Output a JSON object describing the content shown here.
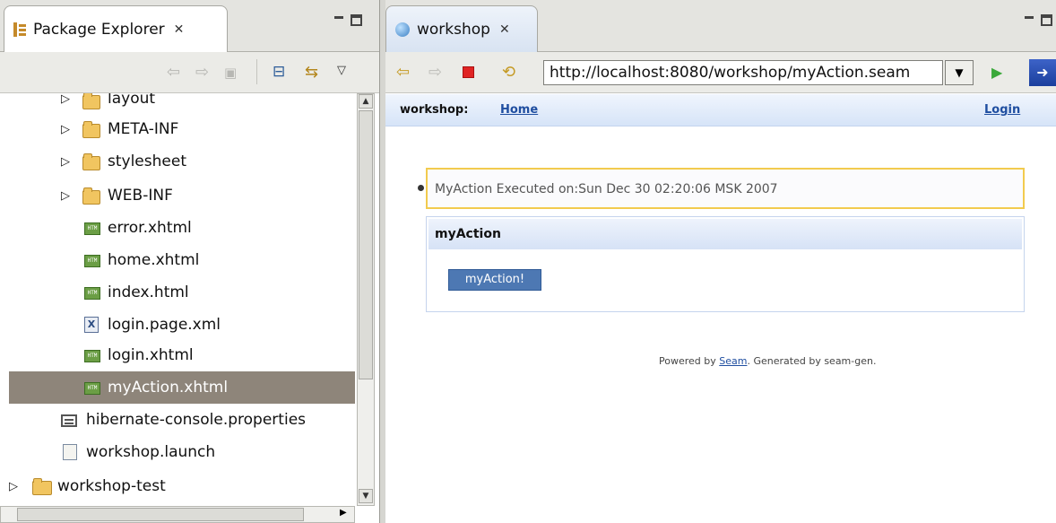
{
  "left_pane": {
    "tab_title": "Package Explorer",
    "close_glyph": "✕",
    "tree": [
      {
        "label": "layout",
        "icon": "folder-icon",
        "twisty": "▷",
        "level": 1
      },
      {
        "label": "META-INF",
        "icon": "folder-icon",
        "twisty": "▷",
        "level": 1
      },
      {
        "label": "stylesheet",
        "icon": "folder-icon",
        "twisty": "▷",
        "level": 1
      },
      {
        "label": "WEB-INF",
        "icon": "folder-icon",
        "twisty": "▷",
        "level": 1
      },
      {
        "label": "error.xhtml",
        "icon": "html-file-icon",
        "twisty": "",
        "level": 2
      },
      {
        "label": "home.xhtml",
        "icon": "html-file-icon",
        "twisty": "",
        "level": 2
      },
      {
        "label": "index.html",
        "icon": "html-file-icon",
        "twisty": "",
        "level": 2
      },
      {
        "label": "login.page.xml",
        "icon": "xml-file-icon",
        "twisty": "",
        "level": 2
      },
      {
        "label": "login.xhtml",
        "icon": "html-file-icon",
        "twisty": "",
        "level": 2
      },
      {
        "label": "myAction.xhtml",
        "icon": "html-file-icon",
        "twisty": "",
        "level": 2,
        "selected": true
      },
      {
        "label": "hibernate-console.properties",
        "icon": "properties-file-icon",
        "twisty": "",
        "level": 1
      },
      {
        "label": "workshop.launch",
        "icon": "launch-file-icon",
        "twisty": "",
        "level": 1
      },
      {
        "label": "workshop-test",
        "icon": "project-icon",
        "twisty": "▷",
        "level": 0
      }
    ]
  },
  "right_pane": {
    "tab_title": "workshop",
    "close_glyph": "✕",
    "url": "http://localhost:8080/workshop/myAction.seam",
    "page": {
      "app_name": "workshop:",
      "home_link": "Home",
      "login_link": "Login",
      "message": "MyAction Executed on:Sun Dec 30 02:20:06 MSK 2007",
      "panel_title": "myAction",
      "action_button": "myAction!",
      "footer_prefix": "Powered by ",
      "footer_link": "Seam",
      "footer_suffix": ". Generated by seam-gen."
    }
  },
  "colors": {
    "selection": "#8e857a",
    "link": "#1f4ea0",
    "message_border": "#f2cb4e",
    "button": "#4d78b3"
  }
}
